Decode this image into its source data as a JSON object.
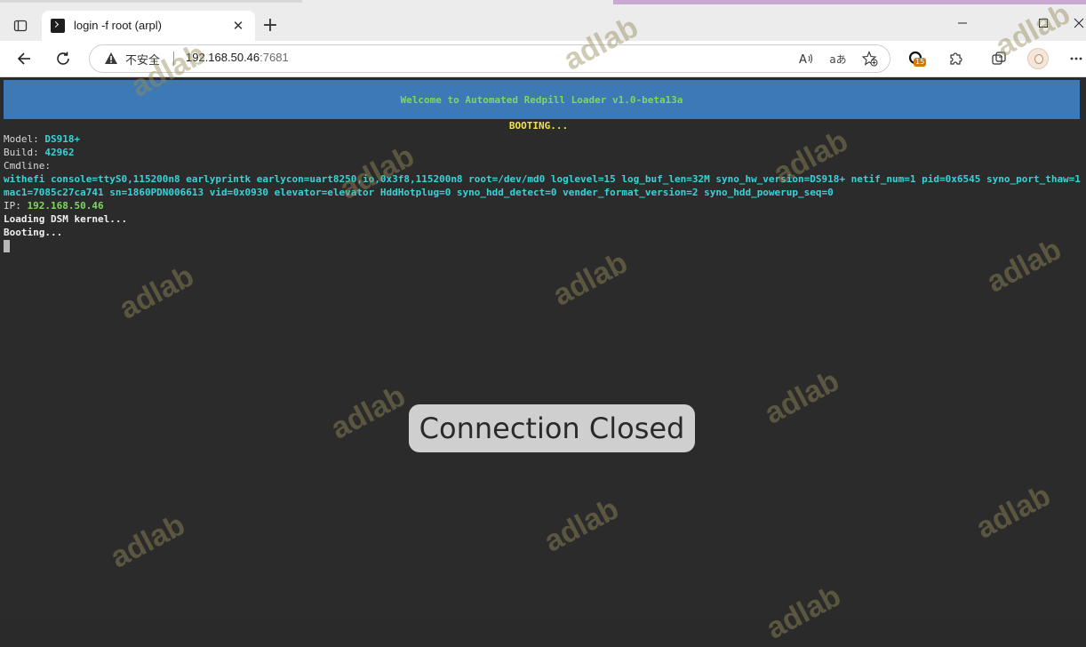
{
  "browser": {
    "tab": {
      "title": "login -f root (arpl)",
      "close": "✕"
    },
    "new_tab": "+",
    "address": {
      "security_label": "不安全",
      "host": "192.168.50.46",
      "port": ":7681"
    },
    "addr_icons": {
      "read_aloud": "A⁾",
      "translate": "aあ"
    },
    "extension_badge": "15",
    "window_controls": {
      "minimize": "—",
      "maximize": "□",
      "close": "✕"
    }
  },
  "terminal": {
    "banner": "Welcome to Automated Redpill Loader v1.0-beta13a",
    "status": "BOOTING...",
    "model_label": "Model: ",
    "model_value": "DS918+",
    "build_label": "Build: ",
    "build_value": "42962",
    "cmdline_label": "Cmdline:",
    "cmdline_value": "withefi console=ttyS0,115200n8 earlyprintk earlycon=uart8250,io,0x3f8,115200n8 root=/dev/md0 loglevel=15 log_buf_len=32M syno_hw_version=DS918+ netif_num=1 pid=0x6545 syno_port_thaw=1 mac1=7085c27ca741 sn=1860PDN006613 vid=0x0930 elevator=elevator HddHotplug=0 syno_hdd_detect=0 vender_format_version=2 syno_hdd_powerup_seq=0",
    "ip_label": "IP: ",
    "ip_value": "192.168.50.46",
    "loading": "Loading DSM kernel...",
    "booting": "Booting...",
    "overlay": "Connection Closed"
  },
  "watermark": "adlab",
  "colors": {
    "banner_bg": "#3c79b5",
    "banner_text": "#7dd860",
    "status_yellow": "#f2e14a",
    "value_cyan": "#38d3d8",
    "terminal_bg": "#2b2b2b"
  }
}
